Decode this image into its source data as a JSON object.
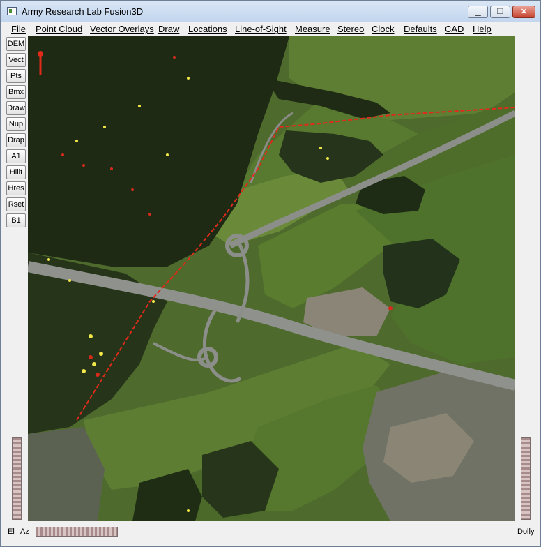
{
  "window": {
    "title": "Army Research Lab Fusion3D",
    "icon": "app-window-icon",
    "controls": {
      "minimize": "▁",
      "maximize": "❐",
      "close": "✕"
    }
  },
  "menu": [
    {
      "label": "File"
    },
    {
      "label": "Point Cloud"
    },
    {
      "label": "Vector Overlays"
    },
    {
      "label": "Draw"
    },
    {
      "label": "Locations"
    },
    {
      "label": "Line-of-Sight"
    },
    {
      "label": "Measure"
    },
    {
      "label": "Stereo"
    },
    {
      "label": "Clock"
    },
    {
      "label": "Defaults"
    },
    {
      "label": "CAD"
    },
    {
      "label": "Help"
    }
  ],
  "toolbar": [
    {
      "label": "DEM"
    },
    {
      "label": "Vect"
    },
    {
      "label": "Pts"
    },
    {
      "label": "Bmx"
    },
    {
      "label": "Draw"
    },
    {
      "label": "Nup"
    },
    {
      "label": "Drap"
    },
    {
      "label": "A1"
    },
    {
      "label": "Hilit"
    },
    {
      "label": "Hres"
    },
    {
      "label": "Rset"
    },
    {
      "label": "B1"
    }
  ],
  "bottom": {
    "el_label": "El",
    "az_label": "Az",
    "dolly_label": "Dolly"
  },
  "colors": {
    "overlay_line": "#e02a1a",
    "point_hi": "#f2e84a",
    "point_lo": "#d82a1a",
    "field_green": "#4e6d2a",
    "road": "#8c8e8a"
  }
}
